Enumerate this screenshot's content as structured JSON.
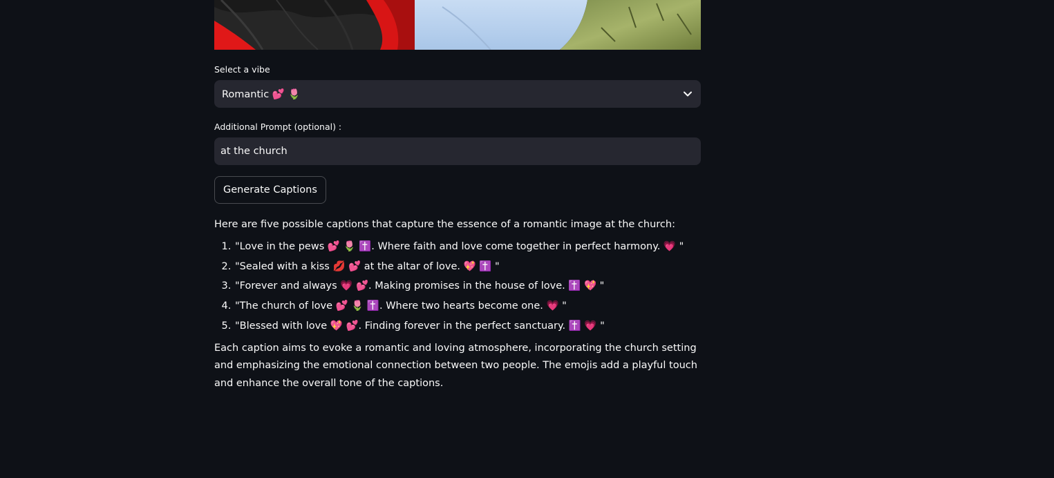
{
  "vibe_field": {
    "label": "Select a vibe",
    "selected": "Romantic 💕 🌷"
  },
  "prompt_field": {
    "label": "Additional Prompt (optional) :",
    "value": "at the church"
  },
  "generate_button": {
    "label": "Generate Captions"
  },
  "result": {
    "intro": "Here are five possible captions that capture the essence of a romantic image at the church:",
    "captions": [
      "\"Love in the pews 💕 🌷 ✝️. Where faith and love come together in perfect harmony. 💗 \"",
      "\"Sealed with a kiss 💋 💕 at the altar of love. 💖 ✝️ \"",
      "\"Forever and always 💗 💕. Making promises in the house of love. ✝️ 💖 \"",
      "\"The church of love 💕 🌷 ✝️. Where two hearts become one. 💗 \"",
      "\"Blessed with love 💖 💕. Finding forever in the perfect sanctuary. ✝️ 💗 \""
    ],
    "outro": "Each caption aims to evoke a romantic and loving atmosphere, incorporating the church setting and emphasizing the emotional connection between two people. The emojis add a playful touch and enhance the overall tone of the captions."
  },
  "icons": {
    "dropdown": "chevron-down-icon"
  },
  "colors": {
    "background": "#0e1117",
    "widget_background": "#262730",
    "text": "#fafafa"
  }
}
